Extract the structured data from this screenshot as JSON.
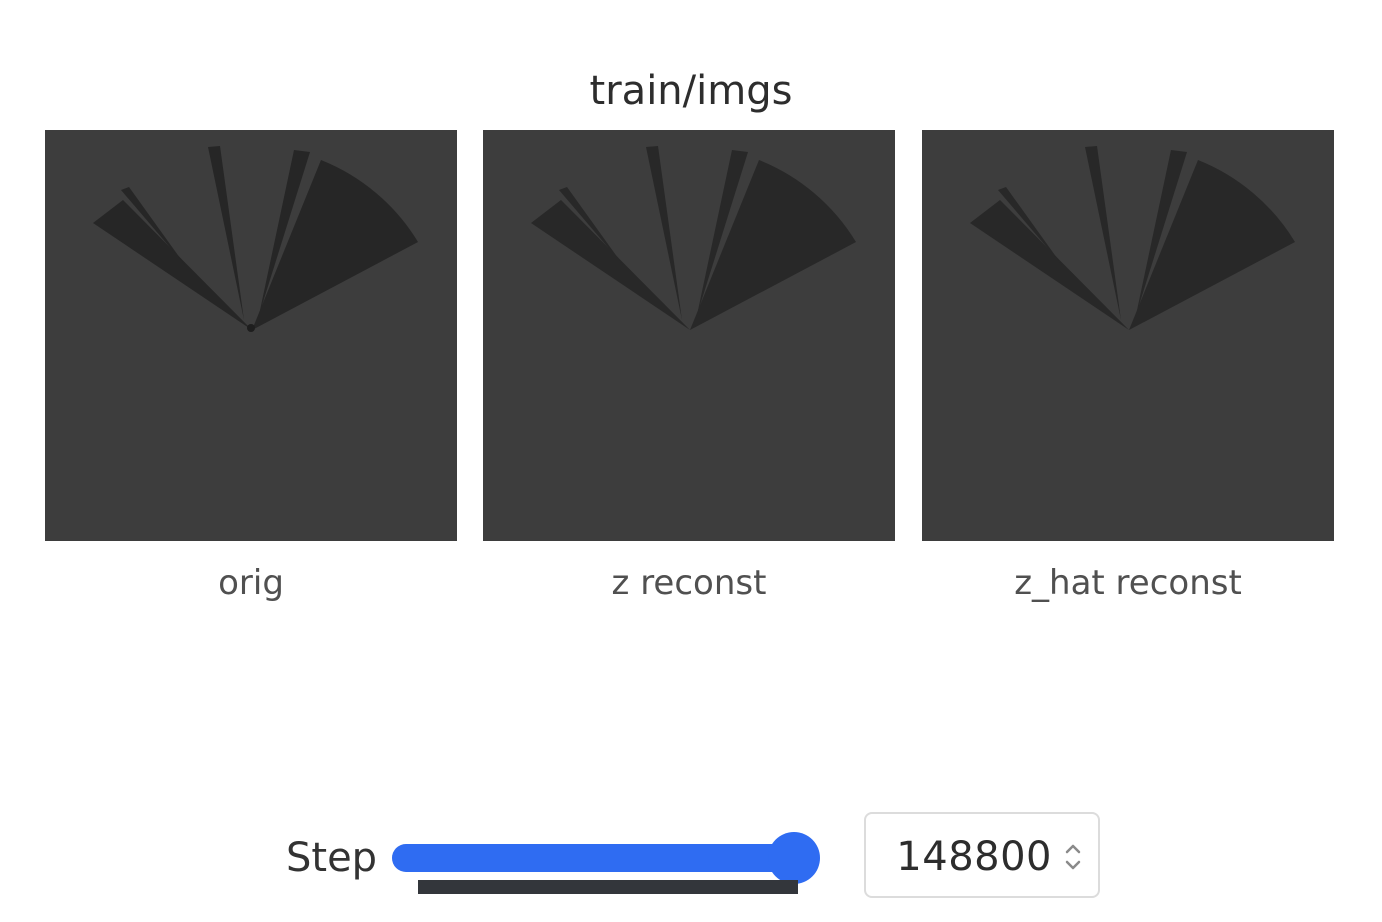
{
  "panel": {
    "title": "train/imgs"
  },
  "images": [
    {
      "caption": "orig"
    },
    {
      "caption": "z reconst"
    },
    {
      "caption": "z_hat reconst"
    }
  ],
  "step": {
    "label": "Step",
    "value": "148800",
    "slider_fraction": 1.0
  },
  "colors": {
    "accent": "#2f6cf2",
    "image_background": "#3d3d3d",
    "image_shape": "#262626"
  },
  "icons": {
    "spinner": "up-down-chevron-icon"
  }
}
